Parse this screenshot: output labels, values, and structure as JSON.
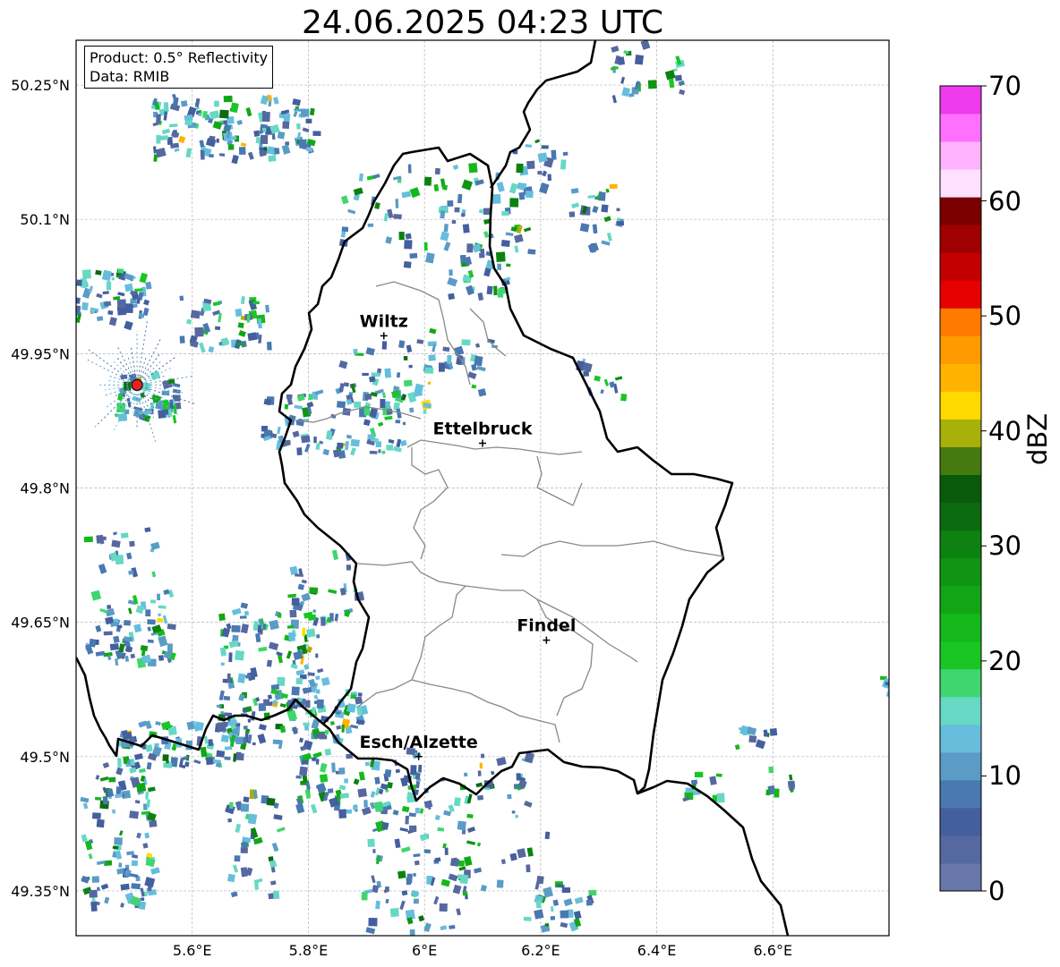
{
  "title": "24.06.2025 04:23 UTC",
  "info": {
    "product": "Product: 0.5° Reflectivity",
    "data": "Data: RMIB"
  },
  "axes": {
    "lon_range": [
      5.4,
      6.8
    ],
    "lat_range": [
      49.3,
      50.3
    ],
    "lon_ticks": [
      "5.6°E",
      "5.8°E",
      "6°E",
      "6.2°E",
      "6.4°E",
      "6.6°E"
    ],
    "lat_ticks": [
      "50.25°N",
      "50.1°N",
      "49.95°N",
      "49.8°N",
      "49.65°N",
      "49.5°N",
      "49.35°N"
    ],
    "grid": true
  },
  "cities": [
    {
      "name": "Wiltz",
      "lon": 5.93,
      "lat": 49.97
    },
    {
      "name": "Ettelbruck",
      "lon": 6.1,
      "lat": 49.85
    },
    {
      "name": "Findel",
      "lon": 6.21,
      "lat": 49.63
    },
    {
      "name": "Esch/Alzette",
      "lon": 5.99,
      "lat": 49.5
    }
  ],
  "radar_site": {
    "lon": 5.505,
    "lat": 49.915,
    "color": "#e8221d"
  },
  "colorbar": {
    "label": "dBZ",
    "min": 0,
    "max": 70,
    "step": 2.5,
    "ticks": [
      "0",
      "10",
      "20",
      "30",
      "40",
      "50",
      "60",
      "70"
    ],
    "colors": [
      "#6677a8",
      "#5668a0",
      "#445f9e",
      "#4a78b0",
      "#5a9cc6",
      "#66bedc",
      "#66d8c4",
      "#3fd66f",
      "#19c623",
      "#14b81a",
      "#12a616",
      "#0f9512",
      "#0d8210",
      "#0b6b0e",
      "#0a5a0c",
      "#467a10",
      "#a8b00a",
      "#ffd900",
      "#ffb300",
      "#ff9a00",
      "#ff7a00",
      "#e60000",
      "#c20000",
      "#a00000",
      "#7b0000",
      "#ffe0ff",
      "#ffb3ff",
      "#ff70ff",
      "#ee3bee"
    ]
  }
}
